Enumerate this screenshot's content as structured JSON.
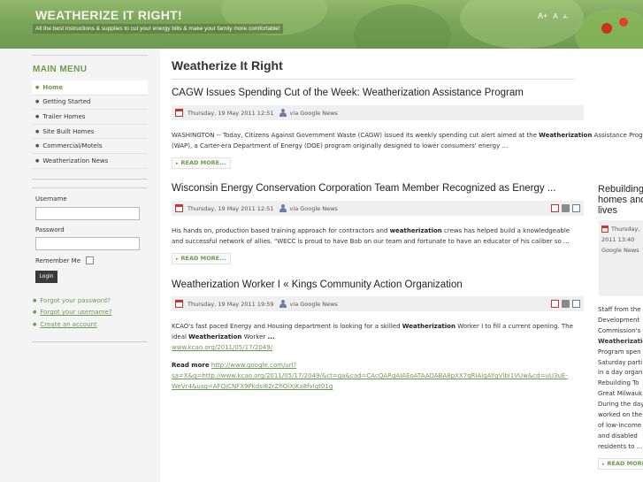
{
  "header": {
    "title": "WEATHERIZE IT RIGHT!",
    "tagline": "All the best instructions & supplies to cut your energy bills & make your family more comfortable!",
    "font_controls": [
      "A+",
      "A",
      "A-"
    ]
  },
  "sidebar": {
    "menu_title": "MAIN MENU",
    "items": [
      {
        "label": "Home",
        "active": true
      },
      {
        "label": "Getting Started"
      },
      {
        "label": "Trailer Homes"
      },
      {
        "label": "Site Built Homes"
      },
      {
        "label": "Commercial/Motels"
      },
      {
        "label": "Weatherization News"
      }
    ],
    "login": {
      "username_label": "Username",
      "password_label": "Password",
      "remember_label": "Remember Me",
      "button_label": "Login",
      "links": [
        "Forgot your password?",
        "Forgot your username?",
        "Create an account"
      ]
    }
  },
  "main": {
    "heading": "Weatherize It Right",
    "articles": [
      {
        "title": "CAGW Issues Spending Cut of the Week: Weatherization Assistance Program",
        "date": "Thursday, 19 May 2011 12:51",
        "source": "via Google News",
        "body_line1": "WASHINGTON -- Today, Citizens Against Government Waste (CAGW) issued its weekly spending cut alert aimed at the Weatherization Assistance Program",
        "body_line2": "(WAP), a Carter-era Department of Energy (DOE) program originally designed to lower consumers' energy ...",
        "read_more": "READ MORE..."
      },
      {
        "title": "Wisconsin Energy Conservation Corporation Team Member Recognized as Energy ...",
        "date": "Thursday, 19 May 2011 12:51",
        "source": "via Google News",
        "body_line1": "His hands on, production based training approach for contractors and weatherization crews has helped build a knowledgeable",
        "body_line2": "and successful network of allies. \"WECC is proud to have Bob on our team and fortunate to have an educator of his caliber so ...",
        "read_more": "READ MORE..."
      },
      {
        "title": "Weatherization Worker I « Kings Community Action Organization",
        "date": "Thursday, 19 May 2011 19:59",
        "source": "via Google News",
        "body_line1": "KCAO's fast paced Energy and Housing department is looking for a skilled Weatherization Worker I to fill a current opening. The",
        "body_line2": "ideal Weatherization Worker ...",
        "body_link": "www.kcao.org/2011/05/17/2049/",
        "read_more_label": "Read more",
        "read_more_url_1": "http://www.google.com/url?",
        "read_more_url_2": "sa=X&q=http://www.kcao.org/2011/05/17/2049/&ct=ga&cad=CAcQARgAIAEoATAAOABA8pXX7gRIAlgAYgVlbi1VUw&cd=uU3uE-",
        "read_more_url_3": "WeVr4&usg=AFQjCNFX9Pkdsi82rZhOiXjKx8fvlgt01g"
      }
    ]
  },
  "right_column": {
    "title": "Rebuilding homes and lives",
    "meta_line1": "Thursday,",
    "meta_line2": "2011 13:40",
    "meta_line3": "Google News",
    "body_lines": [
      "Staff from the",
      "Development",
      "Commission's",
      "Weatherization",
      "Program spen",
      "Saturday parti",
      "in a day organ",
      "Rebuilding To",
      "Great Milwauk",
      "During the day",
      "worked on the",
      "of low-income",
      "and disabled",
      "residents to ..."
    ],
    "read_more": "READ MORE..."
  }
}
